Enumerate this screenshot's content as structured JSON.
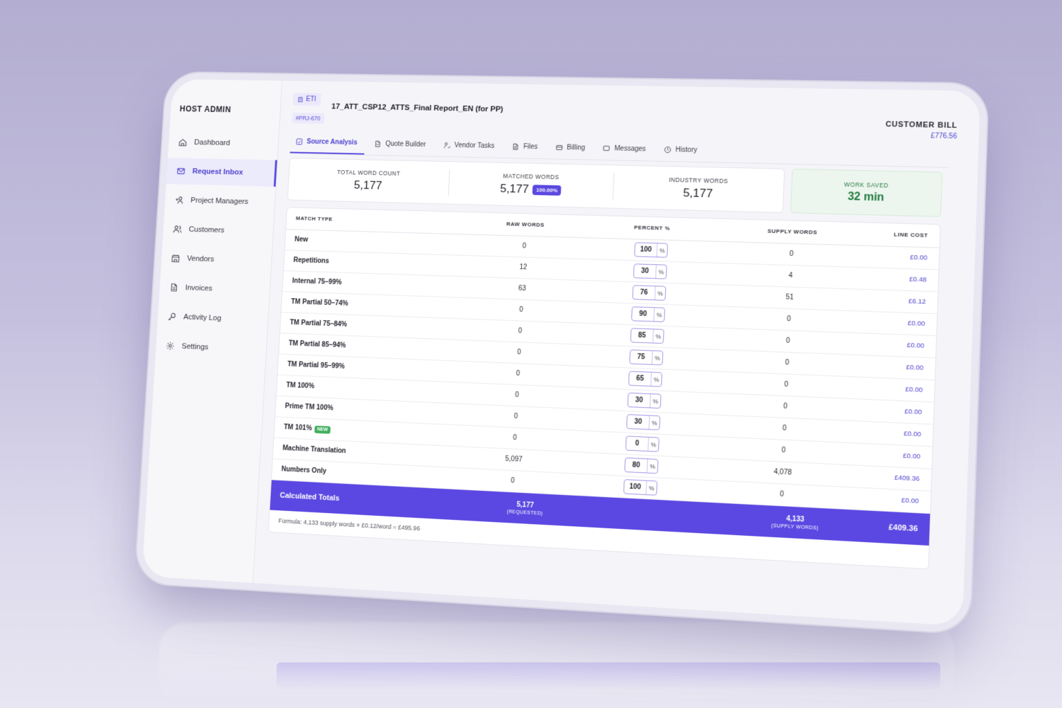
{
  "sidebar": {
    "brand": "HOST ADMIN",
    "items": [
      {
        "label": "Dashboard",
        "icon": "home-icon",
        "active": false
      },
      {
        "label": "Request Inbox",
        "icon": "mail-icon",
        "active": true
      },
      {
        "label": "Project Managers",
        "icon": "users-plus-icon",
        "active": false
      },
      {
        "label": "Customers",
        "icon": "customers-icon",
        "active": false
      },
      {
        "label": "Vendors",
        "icon": "store-icon",
        "active": false
      },
      {
        "label": "Invoices",
        "icon": "invoice-icon",
        "active": false
      },
      {
        "label": "Activity Log",
        "icon": "key-icon",
        "active": false
      },
      {
        "label": "Settings",
        "icon": "gear-icon",
        "active": false
      }
    ]
  },
  "header": {
    "client_badge": "ETI",
    "project_id": "#PRJ-670",
    "project_title": "17_ATT_CSP12_ATTS_Final Report_EN (for PP)",
    "bill_label": "CUSTOMER BILL",
    "bill_value": "£776.56"
  },
  "tabs": [
    {
      "label": "Source Analysis",
      "icon": "analysis-icon",
      "active": true
    },
    {
      "label": "Quote Builder",
      "icon": "document-icon",
      "active": false
    },
    {
      "label": "Vendor Tasks",
      "icon": "person-task-icon",
      "active": false
    },
    {
      "label": "Files",
      "icon": "file-icon",
      "active": false
    },
    {
      "label": "Billing",
      "icon": "billing-icon",
      "active": false
    },
    {
      "label": "Messages",
      "icon": "message-icon",
      "active": false
    },
    {
      "label": "History",
      "icon": "clock-icon",
      "active": false
    }
  ],
  "stats": {
    "total_label": "TOTAL WORD COUNT",
    "total_value": "5,177",
    "matched_label": "MATCHED WORDS",
    "matched_value": "5,177",
    "matched_pct": "100.00%",
    "industry_label": "INDUSTRY WORDS",
    "industry_value": "5,177",
    "saved_label": "WORK SAVED",
    "saved_value": "32 min"
  },
  "table": {
    "headers": [
      "MATCH TYPE",
      "RAW WORDS",
      "PERCENT %",
      "SUPPLY WORDS",
      "LINE COST"
    ],
    "percent_unit": "%",
    "new_badge": "NEW",
    "rows": [
      {
        "type": "New",
        "raw": "0",
        "pct": "100",
        "supply": "0",
        "cost": "£0.00"
      },
      {
        "type": "Repetitions",
        "raw": "12",
        "pct": "30",
        "supply": "4",
        "cost": "£0.48"
      },
      {
        "type": "Internal 75–99%",
        "raw": "63",
        "pct": "76",
        "supply": "51",
        "cost": "£6.12"
      },
      {
        "type": "TM Partial 50–74%",
        "raw": "0",
        "pct": "90",
        "supply": "0",
        "cost": "£0.00"
      },
      {
        "type": "TM Partial 75–84%",
        "raw": "0",
        "pct": "85",
        "supply": "0",
        "cost": "£0.00"
      },
      {
        "type": "TM Partial 85–94%",
        "raw": "0",
        "pct": "75",
        "supply": "0",
        "cost": "£0.00"
      },
      {
        "type": "TM Partial 95–99%",
        "raw": "0",
        "pct": "65",
        "supply": "0",
        "cost": "£0.00"
      },
      {
        "type": "TM 100%",
        "raw": "0",
        "pct": "30",
        "supply": "0",
        "cost": "£0.00"
      },
      {
        "type": "Prime TM 100%",
        "raw": "0",
        "pct": "30",
        "supply": "0",
        "cost": "£0.00"
      },
      {
        "type": "TM 101%",
        "raw": "0",
        "pct": "0",
        "supply": "0",
        "cost": "£0.00",
        "is_new": true
      },
      {
        "type": "Machine Translation",
        "raw": "5,097",
        "pct": "80",
        "supply": "4,078",
        "cost": "£409.36"
      },
      {
        "type": "Numbers Only",
        "raw": "0",
        "pct": "100",
        "supply": "0",
        "cost": "£0.00"
      }
    ],
    "totals": {
      "label": "Calculated Totals",
      "raw": "5,177",
      "raw_sub": "(REQUESTED)",
      "supply": "4,133",
      "supply_sub": "(SUPPLY WORDS)",
      "cost": "£409.36"
    },
    "formula": "Formula: 4,133 supply words × £0.12/word = £495.96"
  },
  "colors": {
    "accent": "#5a48e0",
    "success": "#237a3f",
    "background": "#b3aed1"
  }
}
